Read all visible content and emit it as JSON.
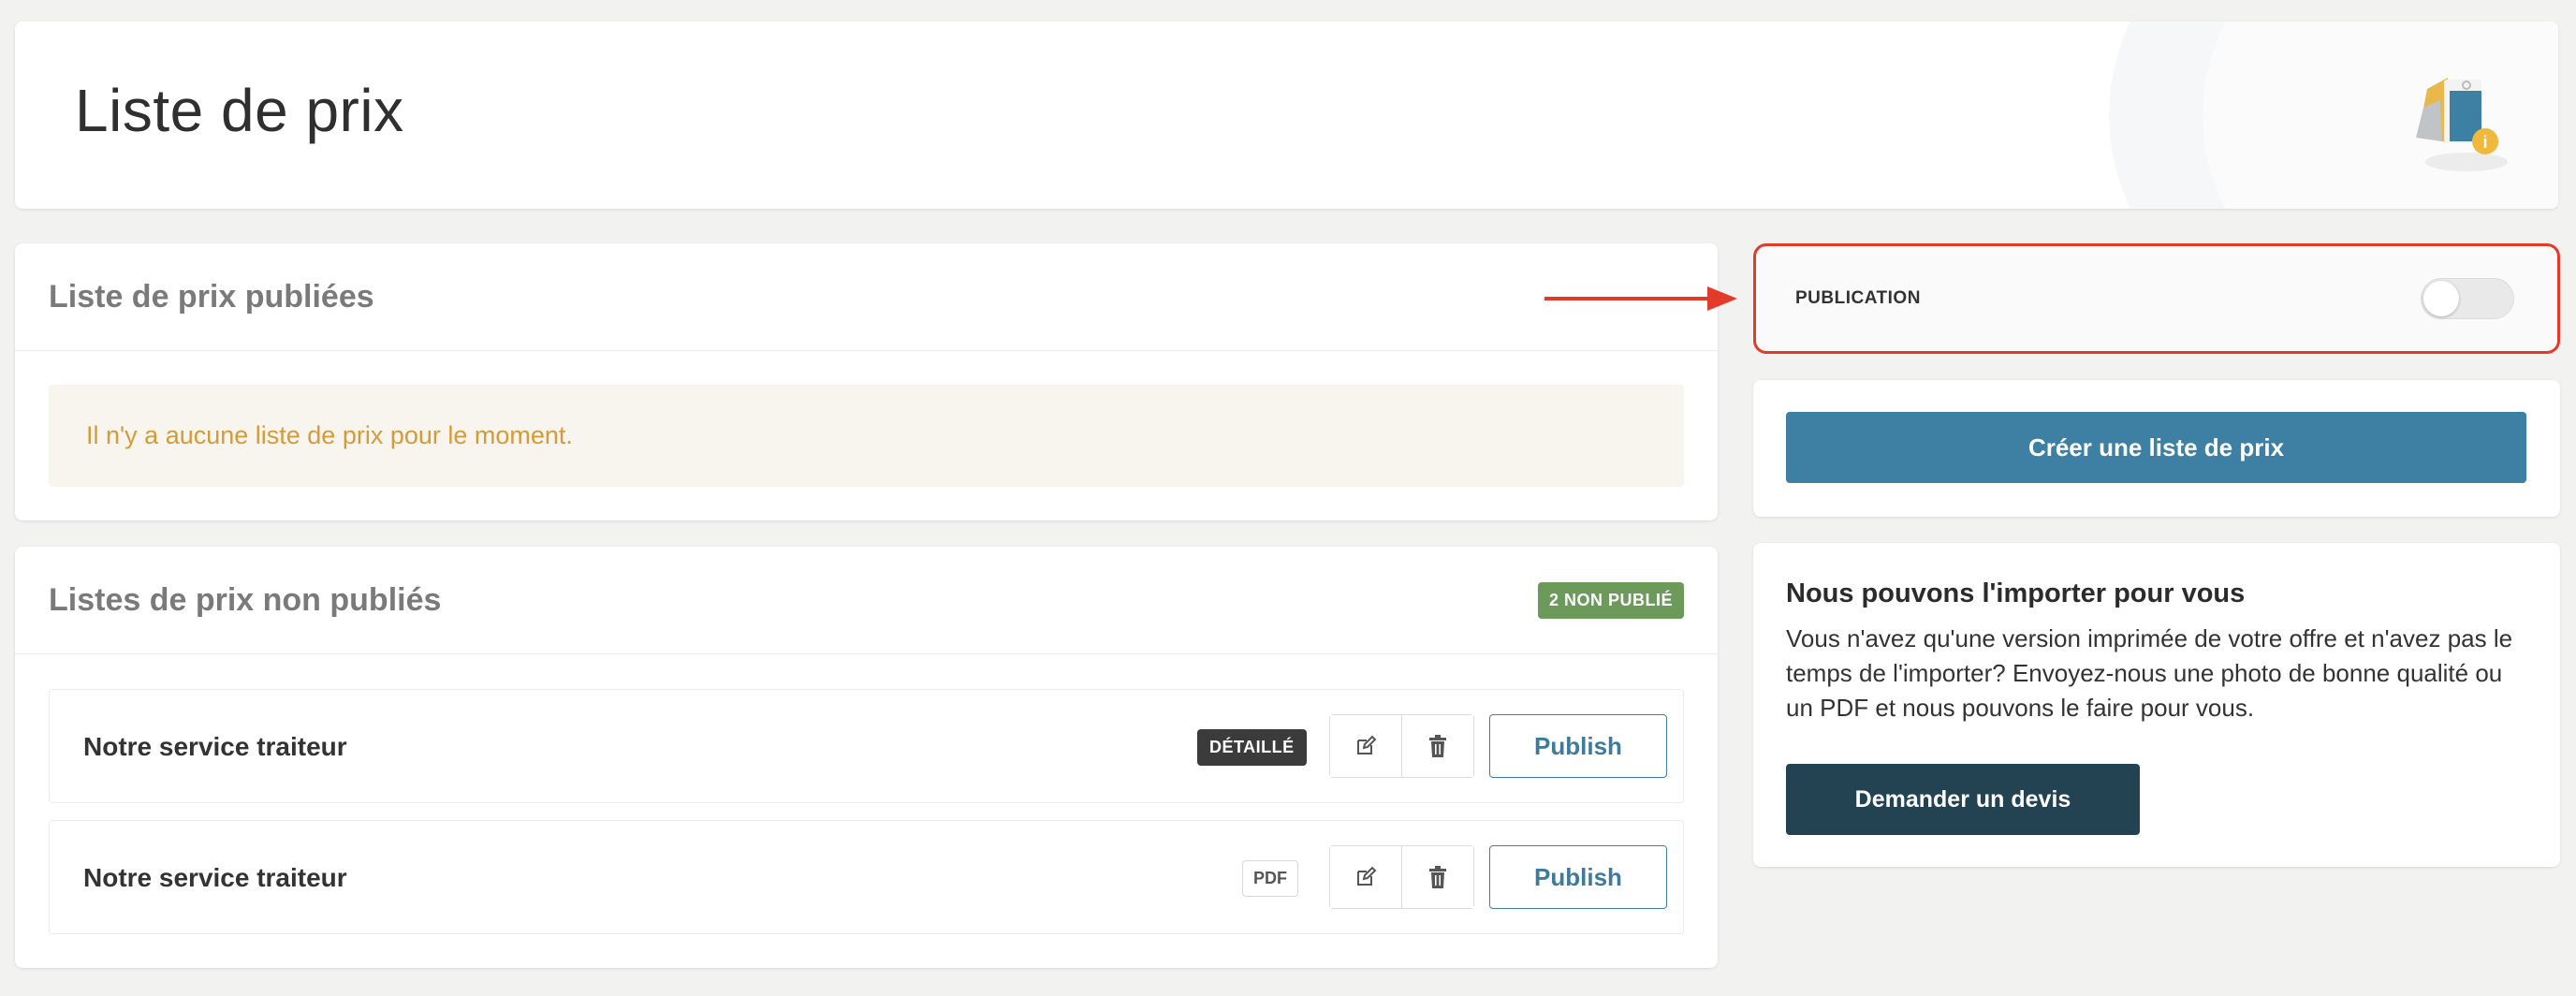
{
  "header": {
    "title": "Liste de prix",
    "illustration_icon": "price-tag-info-icon"
  },
  "published": {
    "title": "Liste de prix publiées",
    "empty_message": "Il n'y a aucune liste de prix pour le moment."
  },
  "unpublished": {
    "title": "Listes de prix non publiés",
    "badge": "2 NON PUBLIÉ",
    "rows": [
      {
        "name": "Notre service traiteur",
        "tag": "DÉTAILLÉ",
        "publish_label": "Publish"
      },
      {
        "name": "Notre service traiteur",
        "tag": "PDF",
        "publish_label": "Publish"
      }
    ]
  },
  "publication": {
    "label": "PUBLICATION",
    "enabled": false
  },
  "create": {
    "button_label": "Créer une liste de prix"
  },
  "import": {
    "title": "Nous pouvons l'importer pour vous",
    "text": "Vous n'avez qu'une version imprimée de votre offre et n'avez pas le temps de l'importer? Envoyez-nous une photo de bonne qualité ou un PDF et nous pouvons le faire pour vous.",
    "button_label": "Demander un devis"
  },
  "colors": {
    "accent": "#3d80a3",
    "dark_button": "#234352",
    "highlight_border": "#e23b2a",
    "badge_green": "#6b9a5b",
    "warning_text": "#d49b3a"
  }
}
